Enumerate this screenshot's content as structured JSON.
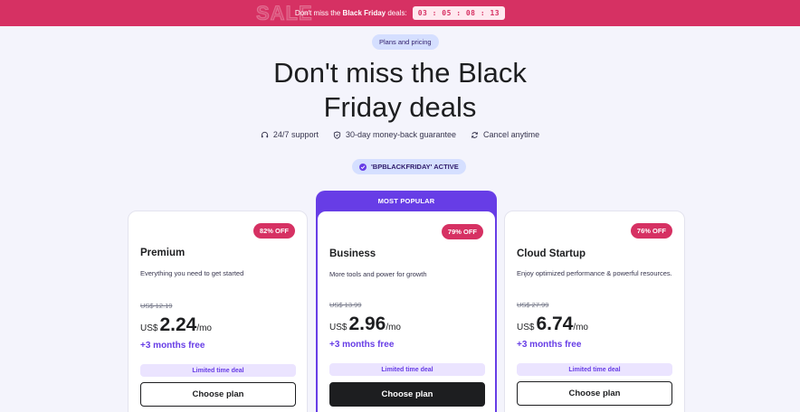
{
  "banner": {
    "watermark": "SALE",
    "prefix": "Don't miss the ",
    "highlight": "Black Friday",
    "suffix": " deals:",
    "countdown": "03 : 05 : 08 : 13"
  },
  "header": {
    "pill": "Plans and pricing",
    "title_line1": "Don't miss the Black",
    "title_line2": "Friday deals",
    "features": [
      {
        "icon": "headset-icon",
        "label": "24/7 support"
      },
      {
        "icon": "shield-icon",
        "label": "30-day money-back guarantee"
      },
      {
        "icon": "refresh-icon",
        "label": "Cancel anytime"
      }
    ],
    "coupon": "'BPBLACKFRIDAY' ACTIVE"
  },
  "plans": [
    {
      "badge": "82% OFF",
      "name": "Premium",
      "description": "Everything you need to get started",
      "old_price": "US$ 12.19",
      "currency": "US$",
      "price": "2.24",
      "period": "/mo",
      "bonus": "+3 months free",
      "deal": "Limited time deal",
      "cta": "Choose plan"
    },
    {
      "ribbon": "MOST POPULAR",
      "badge": "79% OFF",
      "name": "Business",
      "description": "More tools and power for growth",
      "old_price": "US$ 13.99",
      "currency": "US$",
      "price": "2.96",
      "period": "/mo",
      "bonus": "+3 months free",
      "deal": "Limited time deal",
      "cta": "Choose plan"
    },
    {
      "badge": "76% OFF",
      "name": "Cloud Startup",
      "description": "Enjoy optimized performance & powerful resources.",
      "old_price": "US$ 27.99",
      "currency": "US$",
      "price": "6.74",
      "period": "/mo",
      "bonus": "+3 months free",
      "deal": "Limited time deal",
      "cta": "Choose plan"
    }
  ],
  "colors": {
    "banner": "#d63163",
    "accent": "#673de6",
    "background": "#f4f4fc",
    "badge": "#d63163",
    "deal_bg": "#ebe4ff",
    "pill_bg": "#d5dfff"
  }
}
